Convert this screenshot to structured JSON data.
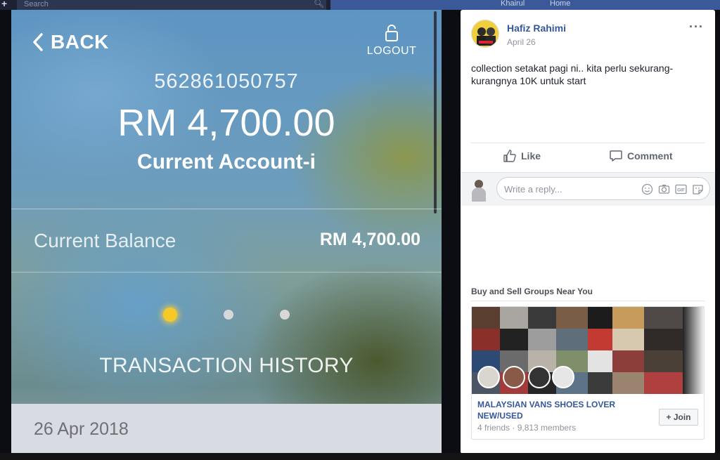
{
  "topbar": {
    "search_placeholder": "Search",
    "nav_name": "Khairul",
    "nav_home": "Home"
  },
  "bank": {
    "back_label": "BACK",
    "logout_label": "LOGOUT",
    "account_number": "562861050757",
    "amount": "RM 4,700.00",
    "account_type": "Current Account-i",
    "balance_label": "Current Balance",
    "balance_value": "RM 4,700.00",
    "pager": {
      "active_index": 0,
      "count": 3,
      "active_color": "#f5c928"
    },
    "history_label": "TRANSACTION HISTORY",
    "first_date": "26 Apr 2018"
  },
  "post": {
    "author": "Hafiz Rahimi",
    "date": "April 26",
    "more_icon": "ellipsis-icon",
    "text": "collection setakat pagi ni.. kita perlu sekurang-kurangnya 10K untuk start",
    "like_label": "Like",
    "comment_label": "Comment",
    "reply_placeholder": "Write a reply...",
    "reply_icons": [
      "emoji-icon",
      "camera-icon",
      "gif-icon",
      "sticker-icon"
    ]
  },
  "groups": {
    "title": "Buy and Sell Groups Near You",
    "card": {
      "name": "MALAYSIAN VANS SHOES LOVER NEW/USED",
      "meta": "4 friends · 9,813 members",
      "join_label": "+ Join"
    }
  },
  "colors": {
    "fb_link": "#365899",
    "fb_text": "#1d2129",
    "muted": "#90949c",
    "bank_accent": "#f5c928"
  }
}
